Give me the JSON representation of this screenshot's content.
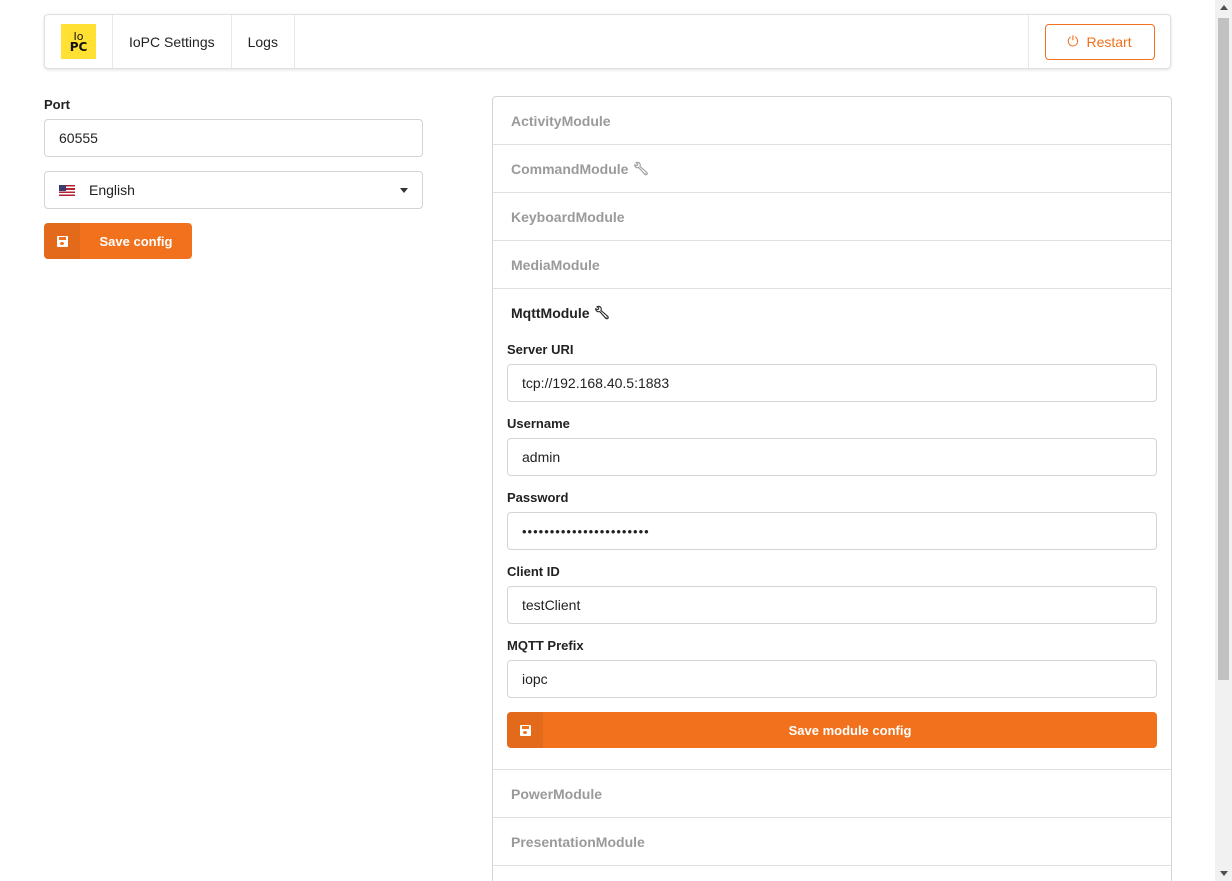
{
  "nav": {
    "logo_line1": "Io",
    "logo_line2": "PC",
    "items": [
      "IoPC Settings",
      "Logs"
    ],
    "restart_label": "Restart"
  },
  "settings": {
    "port_label": "Port",
    "port_value": "60555",
    "language_value": "English",
    "save_label": "Save config"
  },
  "modules": {
    "before": [
      "ActivityModule",
      "CommandModule",
      "KeyboardModule",
      "MediaModule"
    ],
    "command_has_wrench": true,
    "active": {
      "title": "MqttModule",
      "fields": [
        {
          "label": "Server URI",
          "value": "tcp://192.168.40.5:1883"
        },
        {
          "label": "Username",
          "value": "admin"
        },
        {
          "label": "Password",
          "value": "•••••••••••••••••••••••"
        },
        {
          "label": "Client ID",
          "value": "testClient"
        },
        {
          "label": "MQTT Prefix",
          "value": "iopc"
        }
      ],
      "save_label": "Save module config"
    },
    "after": [
      "PowerModule",
      "PresentationModule"
    ]
  },
  "colors": {
    "accent": "#f2711c",
    "logo_bg": "#ffe033"
  }
}
